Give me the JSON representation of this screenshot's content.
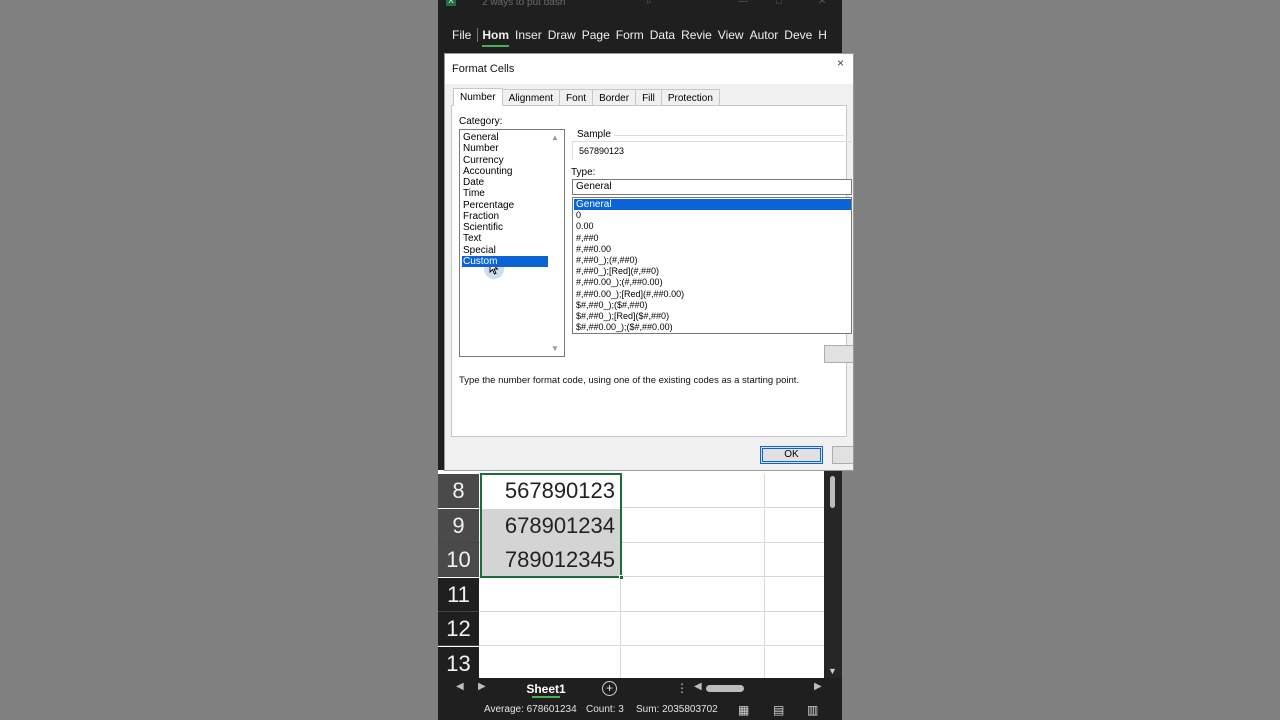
{
  "window": {
    "title": "2 ways to put dash",
    "app_icon": "excel-icon"
  },
  "ribbon": {
    "tabs": [
      {
        "label": "File",
        "active": false
      },
      {
        "label": "Hom",
        "active": true
      },
      {
        "label": "Inser",
        "active": false
      },
      {
        "label": "Draw",
        "active": false
      },
      {
        "label": "Page",
        "active": false
      },
      {
        "label": "Form",
        "active": false
      },
      {
        "label": "Data",
        "active": false
      },
      {
        "label": "Revie",
        "active": false
      },
      {
        "label": "View",
        "active": false
      },
      {
        "label": "Autor",
        "active": false
      },
      {
        "label": "Deve",
        "active": false
      },
      {
        "label": "H",
        "active": false
      }
    ]
  },
  "dialog": {
    "title": "Format Cells",
    "close_glyph": "×",
    "tabs": [
      "Number",
      "Alignment",
      "Font",
      "Border",
      "Fill",
      "Protection"
    ],
    "active_tab": "Number",
    "category_label": "Category:",
    "categories": [
      "General",
      "Number",
      "Currency",
      "Accounting",
      "Date",
      "Time",
      "Percentage",
      "Fraction",
      "Scientific",
      "Text",
      "Special",
      "Custom"
    ],
    "selected_category": "Custom",
    "sample_label": "Sample",
    "sample_value": "567890123",
    "type_label": "Type:",
    "type_value": "General",
    "type_options": [
      "General",
      "0",
      "0.00",
      "#,##0",
      "#,##0.00",
      "#,##0_);(#,##0)",
      "#,##0_);[Red](#,##0)",
      "#,##0.00_);(#,##0.00)",
      "#,##0.00_);[Red](#,##0.00)",
      "$#,##0_);($#,##0)",
      "$#,##0_);[Red]($#,##0)",
      "$#,##0.00_);($#,##0.00)"
    ],
    "selected_type": "General",
    "hint": "Type the number format code, using one of the existing codes as a starting point.",
    "ok_label": "OK"
  },
  "sheet": {
    "rows": [
      {
        "num": "8",
        "value": "567890123",
        "selected": true,
        "active": true
      },
      {
        "num": "9",
        "value": "678901234",
        "selected": true,
        "active": false
      },
      {
        "num": "10",
        "value": "789012345",
        "selected": true,
        "active": false
      },
      {
        "num": "11",
        "value": "",
        "selected": false,
        "active": false
      },
      {
        "num": "12",
        "value": "",
        "selected": false,
        "active": false
      },
      {
        "num": "13",
        "value": "",
        "selected": false,
        "active": false
      }
    ],
    "sheet_tab": "Sheet1",
    "add_sheet_glyph": "+",
    "more_glyph": "⋮"
  },
  "status": {
    "average": "Average: 678601234",
    "count": "Count: 3",
    "sum": "Sum: 2035803702"
  },
  "colors": {
    "accent_blue": "#0a64d6",
    "excel_green": "#1e6b3a",
    "dark_chrome": "#1f1f1f"
  }
}
